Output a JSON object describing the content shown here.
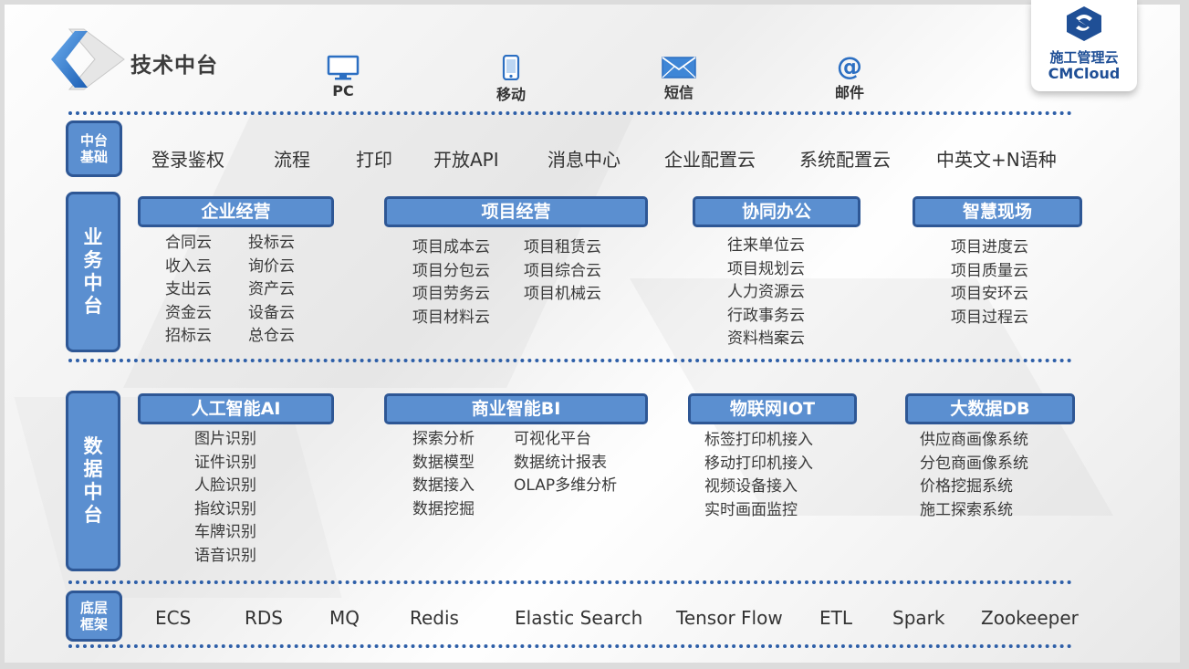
{
  "title": "技术中台",
  "channels": [
    {
      "label": "PC",
      "icon": "monitor-icon"
    },
    {
      "label": "移动",
      "icon": "mobile-icon"
    },
    {
      "label": "短信",
      "icon": "envelope-icon"
    },
    {
      "label": "邮件",
      "icon": "at-icon"
    }
  ],
  "brand": {
    "cn": "施工管理云",
    "en": "CMCloud",
    "color": "#1f4f96"
  },
  "colors": {
    "accent": "#5b8fd0",
    "border": "#2e5795",
    "dots": "#2e5fa8"
  },
  "foundation": {
    "label": "中台基础",
    "items": [
      "登录鉴权",
      "流程",
      "打印",
      "开放API",
      "消息中心",
      "企业配置云",
      "系统配置云",
      "中英文+N语种"
    ]
  },
  "business": {
    "label": "业务中台",
    "groups": [
      {
        "title": "企业经营",
        "col1": [
          "合同云",
          "收入云",
          "支出云",
          "资金云",
          "招标云"
        ],
        "col2": [
          "投标云",
          "询价云",
          "资产云",
          "设备云",
          "总仓云"
        ]
      },
      {
        "title": "项目经营",
        "col1": [
          "项目成本云",
          "项目分包云",
          "项目劳务云",
          "项目材料云"
        ],
        "col2": [
          "项目租赁云",
          "项目综合云",
          "项目机械云"
        ]
      },
      {
        "title": "协同办公",
        "col1": [
          "往来单位云",
          "项目规划云",
          "人力资源云",
          "行政事务云",
          "资料档案云"
        ]
      },
      {
        "title": "智慧现场",
        "col1": [
          "项目进度云",
          "项目质量云",
          "项目安环云",
          "项目过程云"
        ]
      }
    ]
  },
  "data_platform": {
    "label": "数据中台",
    "groups": [
      {
        "title": "人工智能AI",
        "col1": [
          "图片识别",
          "证件识别",
          "人脸识别",
          "指纹识别",
          "车牌识别",
          "语音识别"
        ]
      },
      {
        "title": "商业智能BI",
        "col1": [
          "探索分析",
          "数据模型",
          "数据接入",
          "数据挖掘"
        ],
        "col2": [
          "可视化平台",
          "数据统计报表",
          "OLAP多维分析"
        ]
      },
      {
        "title": "物联网IOT",
        "col1": [
          "标签打印机接入",
          "移动打印机接入",
          "视频设备接入",
          "实时画面监控"
        ]
      },
      {
        "title": "大数据DB",
        "col1": [
          "供应商画像系统",
          "分包商画像系统",
          "价格挖掘系统",
          "施工探索系统"
        ]
      }
    ]
  },
  "framework": {
    "label": "底层框架",
    "items": [
      "ECS",
      "RDS",
      "MQ",
      "Redis",
      "Elastic Search",
      "Tensor Flow",
      "ETL",
      "Spark",
      "Zookeeper"
    ]
  }
}
